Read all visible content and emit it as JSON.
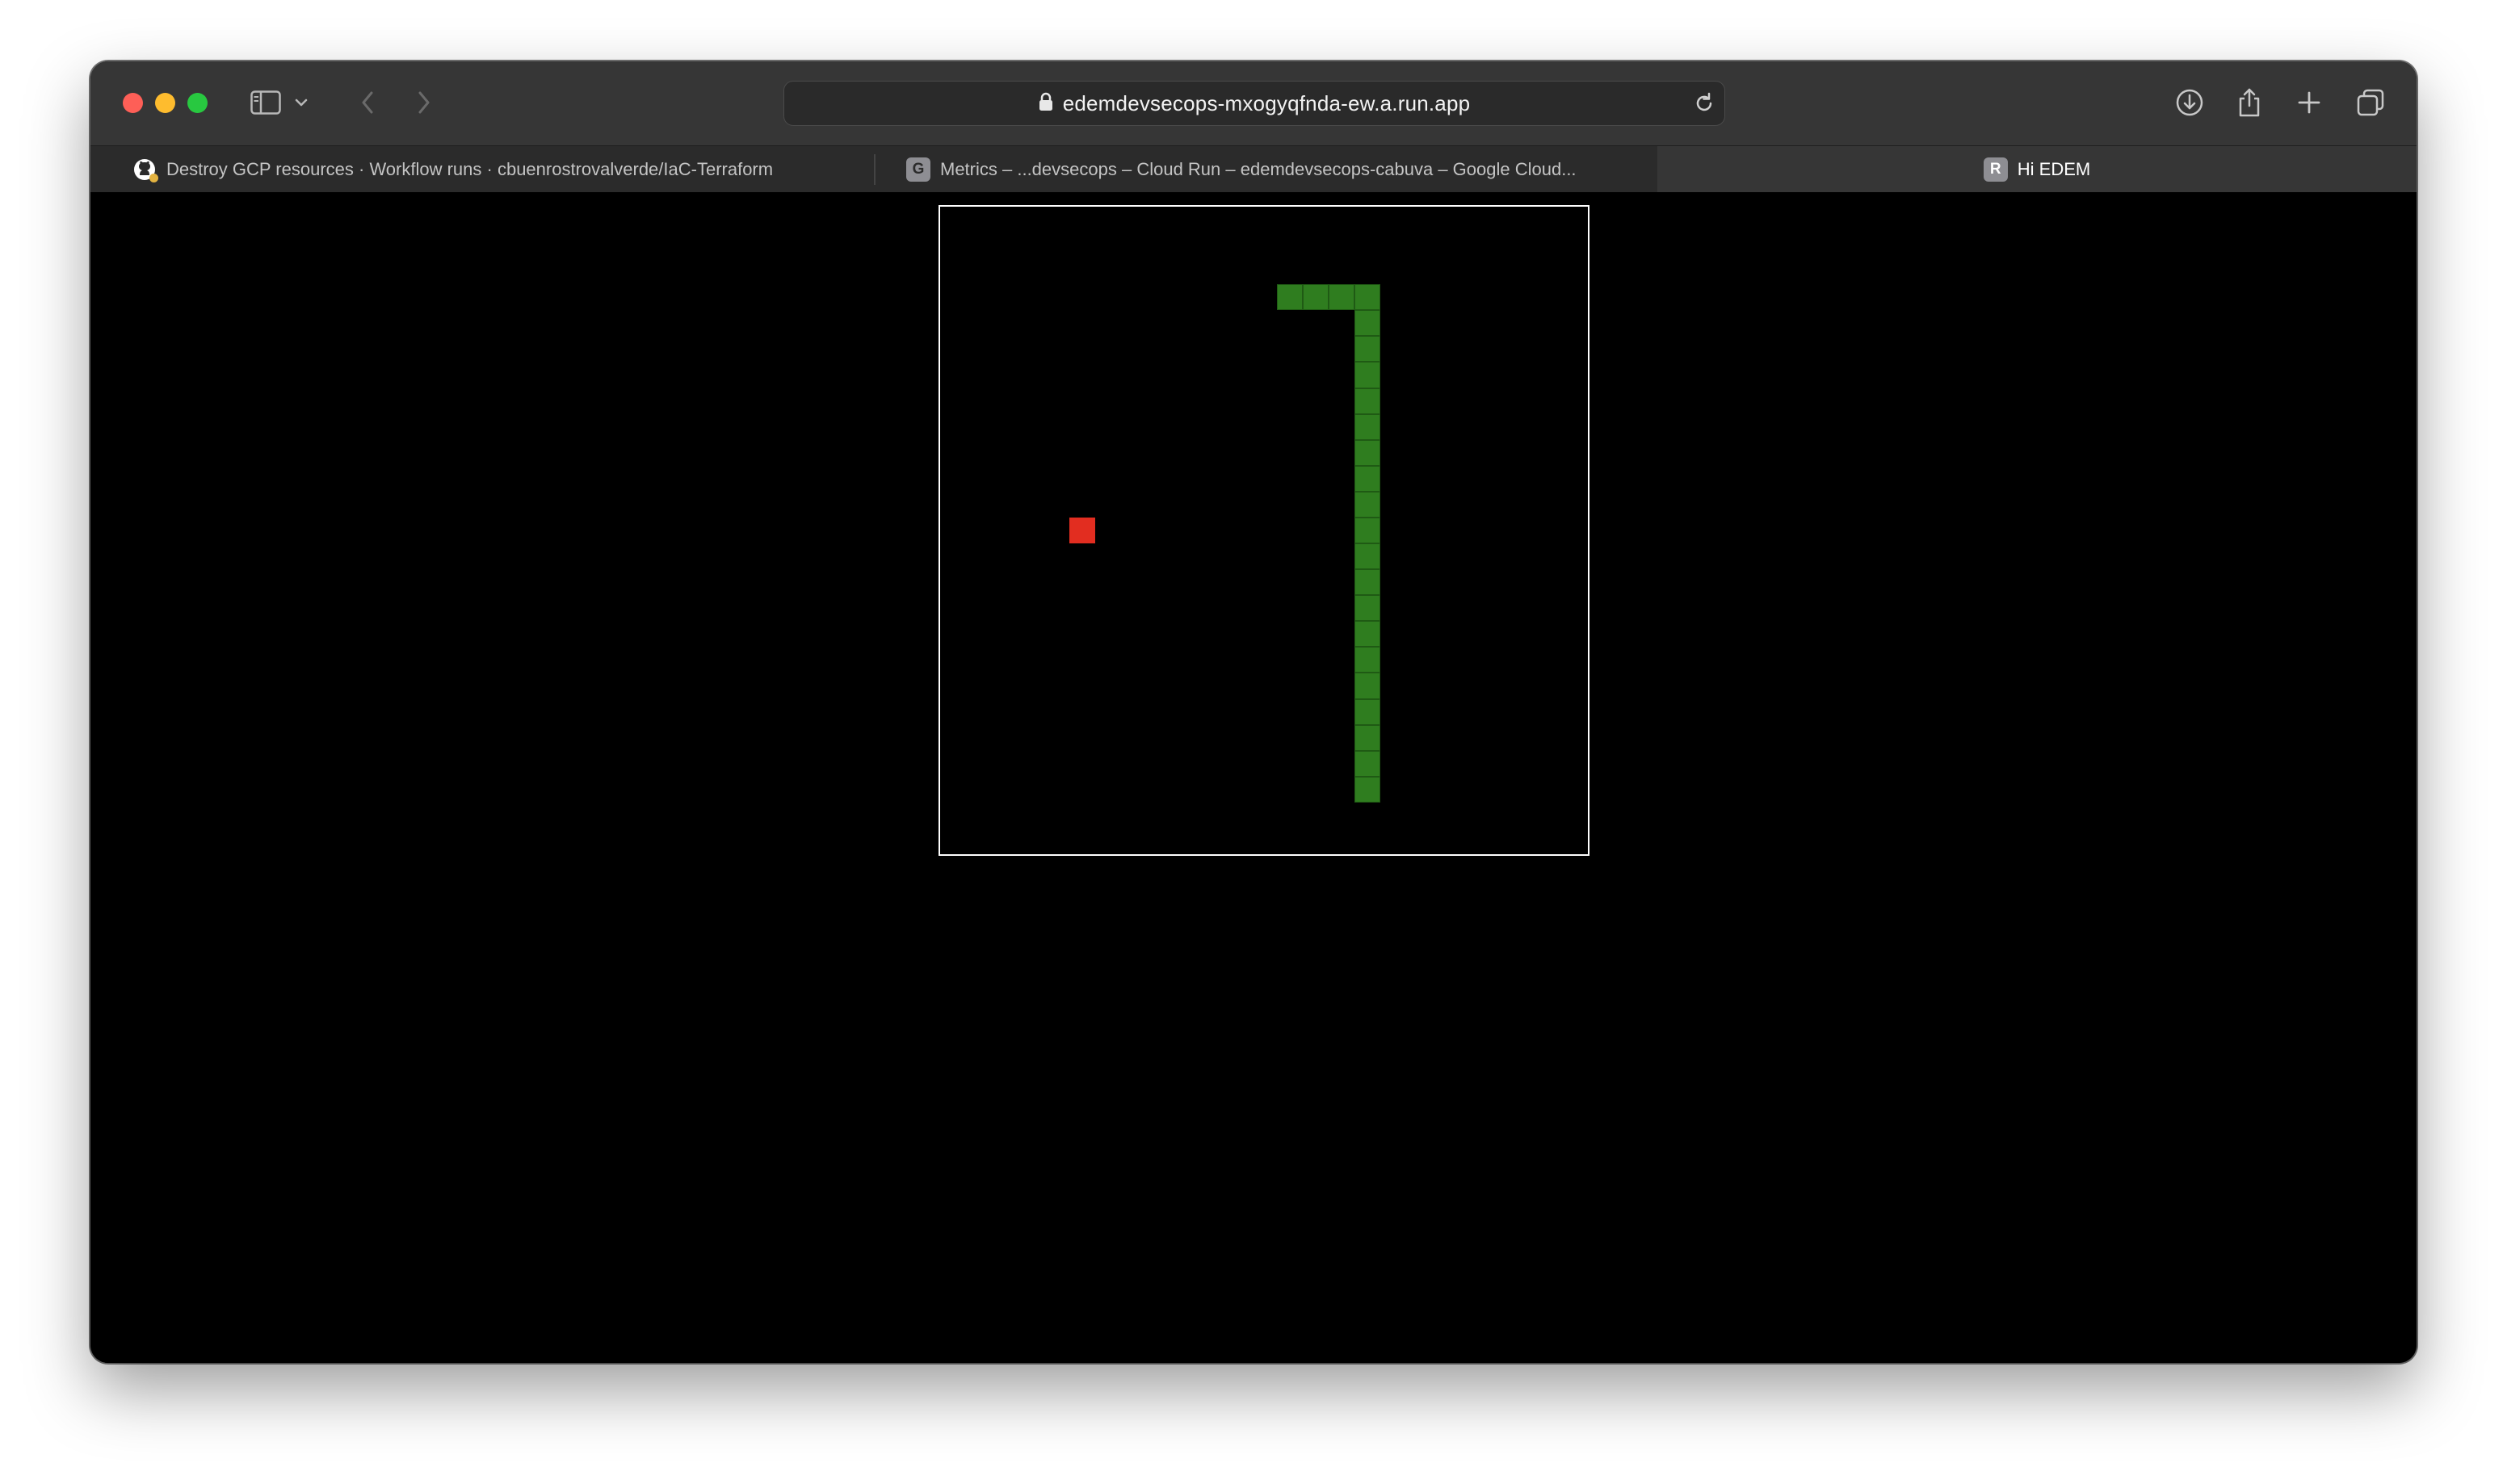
{
  "browser": {
    "url": "edemdevsecops-mxogyqfnda-ew.a.run.app",
    "tabs": [
      {
        "title": "Destroy GCP resources · Workflow runs · cbuenrostrovalverde/IaC-Terraform",
        "favicon": "github-icon",
        "active": false
      },
      {
        "title": "Metrics – ...devsecops – Cloud Run – edemdevsecops-cabuva – Google Cloud...",
        "favicon": "G",
        "active": false
      },
      {
        "title": "Hi EDEM",
        "favicon": "R",
        "active": true
      }
    ]
  },
  "game": {
    "board_cols": 25,
    "board_rows": 25,
    "snake_color": "#2f7d1f",
    "food_color": "#e22d20",
    "board_border_color": "#ffffff",
    "snake": [
      [
        13,
        3
      ],
      [
        14,
        3
      ],
      [
        15,
        3
      ],
      [
        16,
        3
      ],
      [
        16,
        4
      ],
      [
        16,
        5
      ],
      [
        16,
        6
      ],
      [
        16,
        7
      ],
      [
        16,
        8
      ],
      [
        16,
        9
      ],
      [
        16,
        10
      ],
      [
        16,
        11
      ],
      [
        16,
        12
      ],
      [
        16,
        13
      ],
      [
        16,
        14
      ],
      [
        16,
        15
      ],
      [
        16,
        16
      ],
      [
        16,
        17
      ],
      [
        16,
        18
      ],
      [
        16,
        19
      ],
      [
        16,
        20
      ],
      [
        16,
        21
      ],
      [
        16,
        22
      ]
    ],
    "food": [
      5,
      12
    ]
  }
}
